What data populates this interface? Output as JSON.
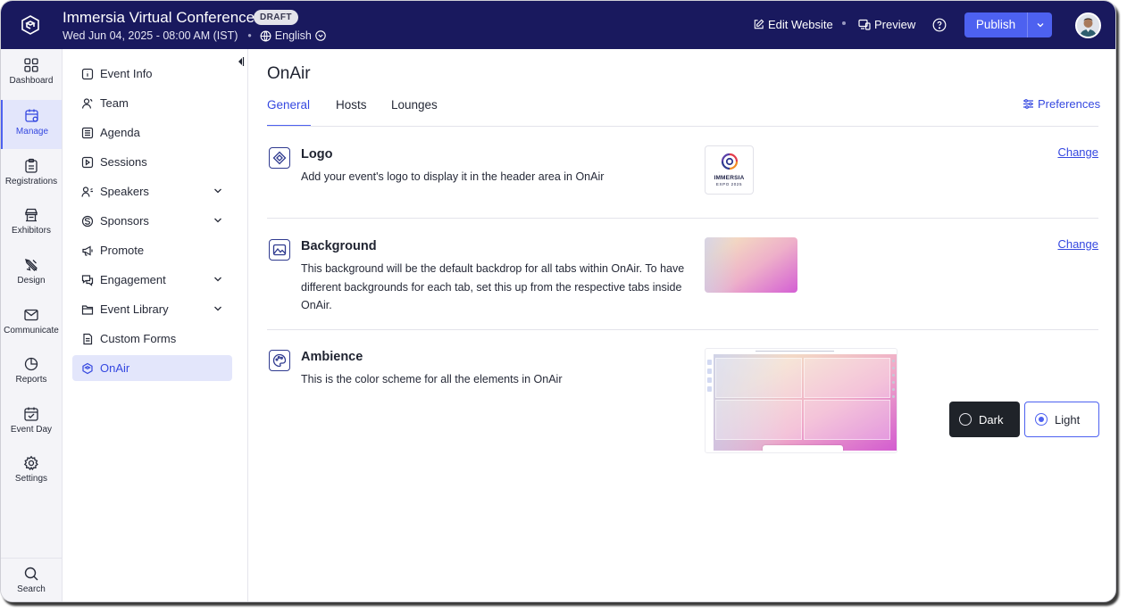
{
  "header": {
    "app_title": "Immersia Virtual Conference",
    "badge": "DRAFT",
    "datetime": "Wed Jun 04, 2025 - 08:00 AM (IST)",
    "language": "English",
    "edit_website": "Edit Website",
    "preview": "Preview",
    "publish": "Publish"
  },
  "rail": {
    "items": [
      {
        "label": "Dashboard",
        "icon": "grid-icon"
      },
      {
        "label": "Manage",
        "icon": "calendar-gear-icon"
      },
      {
        "label": "Registrations",
        "icon": "clipboard-icon"
      },
      {
        "label": "Exhibitors",
        "icon": "booth-icon"
      },
      {
        "label": "Design",
        "icon": "pen-ruler-icon"
      },
      {
        "label": "Communicate",
        "icon": "mail-icon"
      },
      {
        "label": "Reports",
        "icon": "pie-chart-icon"
      },
      {
        "label": "Event Day",
        "icon": "calendar-check-icon"
      },
      {
        "label": "Settings",
        "icon": "gear-icon"
      }
    ],
    "search": "Search"
  },
  "subnav": {
    "items": [
      {
        "label": "Event Info"
      },
      {
        "label": "Team"
      },
      {
        "label": "Agenda"
      },
      {
        "label": "Sessions"
      },
      {
        "label": "Speakers"
      },
      {
        "label": "Sponsors"
      },
      {
        "label": "Promote"
      },
      {
        "label": "Engagement"
      },
      {
        "label": "Event Library"
      },
      {
        "label": "Custom Forms"
      },
      {
        "label": "OnAir"
      }
    ]
  },
  "main": {
    "title": "OnAir",
    "tabs": [
      "General",
      "Hosts",
      "Lounges"
    ],
    "preferences": "Preferences",
    "logo": {
      "title": "Logo",
      "desc": "Add your event's logo to display it in the header area in OnAir",
      "brand_name": "IMMERSIA",
      "brand_sub": "EXPO 2025",
      "change": "Change"
    },
    "background": {
      "title": "Background",
      "desc": "This background will be the default backdrop for all tabs within OnAir. To have different backgrounds for each tab, set this up from the respective tabs inside OnAir.",
      "change": "Change"
    },
    "ambience": {
      "title": "Ambience",
      "desc": "This is the color scheme for all the elements in OnAir",
      "dark": "Dark",
      "light": "Light",
      "selected": "Light"
    }
  },
  "colors": {
    "header_bg": "#19195e",
    "accent": "#4d61f0",
    "active_bg": "#e3e6fb"
  }
}
